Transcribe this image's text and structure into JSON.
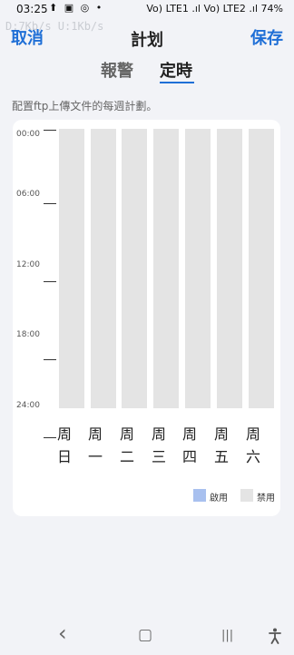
{
  "status_bar": {
    "time": "03:25",
    "left_icons": "⬆ ▣ ◎ •",
    "right_text": "Vo) LTE1 .ıl Vo) LTE2 .ıl 74%",
    "net_speed": "D:7Kb/s  U:1Kb/s"
  },
  "header": {
    "cancel_label": "取消",
    "title": "計划",
    "save_label": "保存"
  },
  "tabs": [
    {
      "label": "報警",
      "active": false
    },
    {
      "label": "定時",
      "active": true
    }
  ],
  "description": "配置ftp上傳文件的每週計劃。",
  "schedule": {
    "time_labels": [
      "00:00",
      "06:00",
      "12:00",
      "18:00",
      "24:00"
    ],
    "days": [
      {
        "line1": "周",
        "line2": "日",
        "state": "disabled"
      },
      {
        "line1": "周",
        "line2": "一",
        "state": "disabled"
      },
      {
        "line1": "周",
        "line2": "二",
        "state": "disabled"
      },
      {
        "line1": "周",
        "line2": "三",
        "state": "disabled"
      },
      {
        "line1": "周",
        "line2": "四",
        "state": "disabled"
      },
      {
        "line1": "周",
        "line2": "五",
        "state": "disabled"
      },
      {
        "line1": "周",
        "line2": "六",
        "state": "disabled"
      }
    ],
    "legend": {
      "enabled_label": "啟用",
      "enabled_color": "#a8c0ef",
      "disabled_label": "禁用",
      "disabled_color": "#e4e4e4"
    }
  },
  "nav_bar": {
    "back_icon": "‹",
    "home_icon": "▢",
    "recents_icon": "|||",
    "accessibility_icon": "accessibility"
  }
}
